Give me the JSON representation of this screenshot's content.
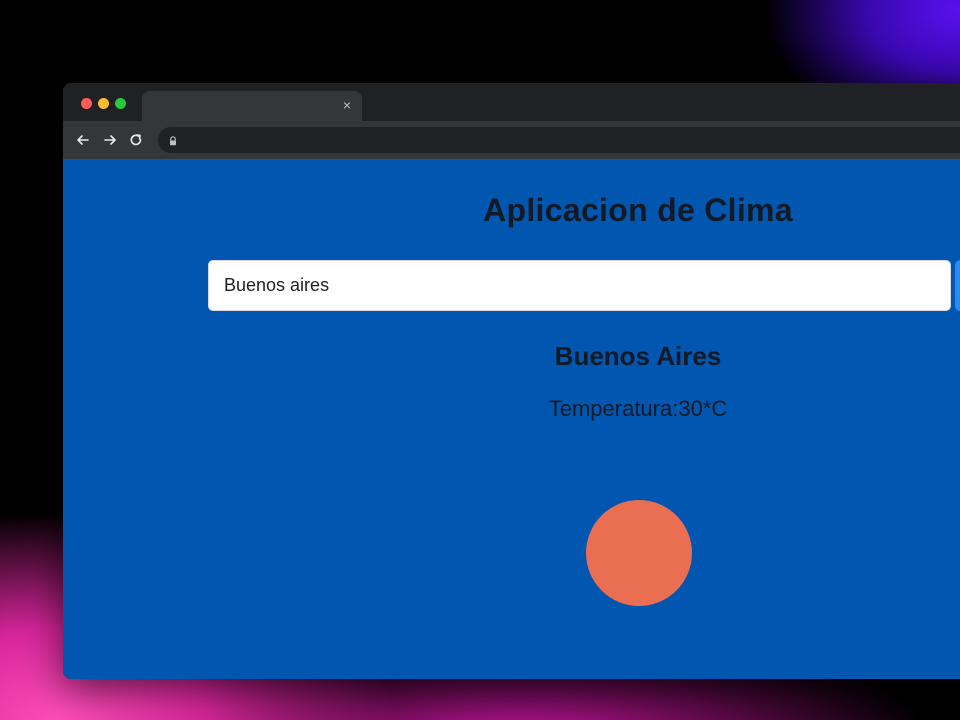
{
  "browser": {
    "tab_close_glyph": "×",
    "traffic_lights": {
      "close_color": "#ff5f57",
      "minimize_color": "#febc2e",
      "maximize_color": "#28c840"
    },
    "icons": {
      "back": "arrow-left-icon",
      "forward": "arrow-right-icon",
      "reload": "reload-icon",
      "lock": "lock-icon"
    }
  },
  "app": {
    "title": "Aplicacion de Clima",
    "search": {
      "value": "Buenos aires"
    },
    "result": {
      "city": "Buenos Aires",
      "temperature": "Temperatura:30*C"
    },
    "weather_icon": "sun-icon",
    "colors": {
      "page_background": "#0156b0",
      "sun": "#ea6e52",
      "button": "#2a8bf2",
      "text": "#121a26"
    }
  }
}
